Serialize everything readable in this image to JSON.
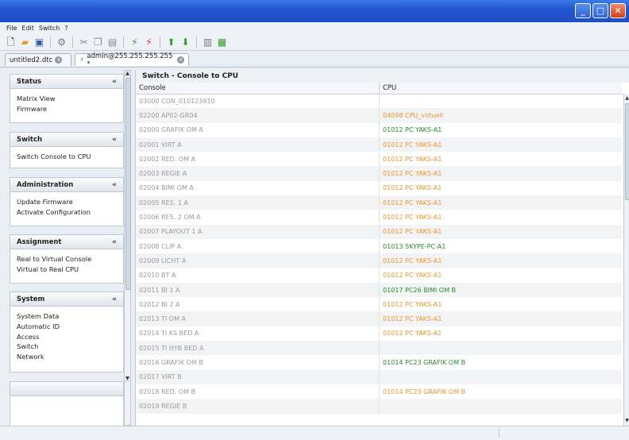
{
  "menu": [
    "File",
    "Edit",
    "Switch",
    "?"
  ],
  "toolbar_icons": [
    "new-file-icon",
    "open-folder-icon",
    "save-icon",
    "settings-icon",
    "cut-icon",
    "copy-icon",
    "paste-icon",
    "connect-icon",
    "disconnect-icon",
    "upload-icon",
    "download-icon",
    "document-icon",
    "export-icon"
  ],
  "tabs": [
    {
      "label": "untitled2.dtc"
    },
    {
      "label": "admin@255.255.255.255 *"
    }
  ],
  "sidebar": [
    {
      "title": "Status",
      "items": [
        "Matrix View",
        "Firmware"
      ]
    },
    {
      "title": "Switch",
      "items": [
        "Switch Console to CPU"
      ]
    },
    {
      "title": "Administration",
      "items": [
        "Update Firmware",
        "Activate Configuration"
      ]
    },
    {
      "title": "Assignment",
      "items": [
        "Real to Virtual Console",
        "Virtual to Real CPU"
      ]
    },
    {
      "title": "System",
      "items": [
        "System Data",
        "Automatic ID",
        "Access",
        "Switch",
        "Network"
      ]
    }
  ],
  "main": {
    "title": "Switch - Console to CPU",
    "columns": [
      "Console",
      "CPU"
    ]
  },
  "colors": {
    "orange": "#f0932b",
    "green": "#2a8a2a"
  },
  "rows": [
    {
      "console": "03000  CON_010123910",
      "cpu": "",
      "color": ""
    },
    {
      "console": "02200  AP02-GR04",
      "cpu": "04098  CPU_virtuell",
      "color": "orange"
    },
    {
      "console": "02000  GRAFIK OM A",
      "cpu": "01012  PC YAKS-A1",
      "color": "green"
    },
    {
      "console": "02001  VIRT A",
      "cpu": "01012  PC YAKS-A1",
      "color": "orange"
    },
    {
      "console": "02002  RED. OM A",
      "cpu": "01012  PC YAKS-A1",
      "color": "orange"
    },
    {
      "console": "02003  REGIE A",
      "cpu": "01012  PC YAKS-A1",
      "color": "orange"
    },
    {
      "console": "02004  BIMI OM A",
      "cpu": "01012  PC YAKS-A1",
      "color": "orange"
    },
    {
      "console": "02005  RES. 1 A",
      "cpu": "01012  PC YAKS-A1",
      "color": "orange"
    },
    {
      "console": "02006  RES. 2 OM A",
      "cpu": "01012  PC YAKS-A1",
      "color": "orange"
    },
    {
      "console": "02007  PLAYOUT 1 A",
      "cpu": "01012  PC YAKS-A1",
      "color": "orange"
    },
    {
      "console": "02008  CLIP A",
      "cpu": "01013  SKYPE-PC-A1",
      "color": "green"
    },
    {
      "console": "02009  LICHT A",
      "cpu": "01012  PC YAKS-A1",
      "color": "orange"
    },
    {
      "console": "02010  BT A",
      "cpu": "01012  PC YAKS-A1",
      "color": "orange"
    },
    {
      "console": "02011  BI 1 A",
      "cpu": "01017  PC26 BIMI OM  B",
      "color": "green"
    },
    {
      "console": "02012  BI 2 A",
      "cpu": "01012  PC YAKS-A1",
      "color": "orange"
    },
    {
      "console": "02013  TI OM A",
      "cpu": "01012  PC YAKS-A1",
      "color": "orange"
    },
    {
      "console": "02014  TI KS BED A",
      "cpu": "01012  PC YAKS-A1",
      "color": "orange"
    },
    {
      "console": "02015  TI HYB BED A",
      "cpu": "",
      "color": ""
    },
    {
      "console": "02016  GRAFIK OM B",
      "cpu": "01014  PC23 GRAFIK OM B",
      "color": "green"
    },
    {
      "console": "02017  VIRT B",
      "cpu": "",
      "color": ""
    },
    {
      "console": "02018  RED. OM B",
      "cpu": "01014  PC23 GRAFIK OM B",
      "color": "orange"
    },
    {
      "console": "02019  REGIE B",
      "cpu": "",
      "color": ""
    }
  ]
}
